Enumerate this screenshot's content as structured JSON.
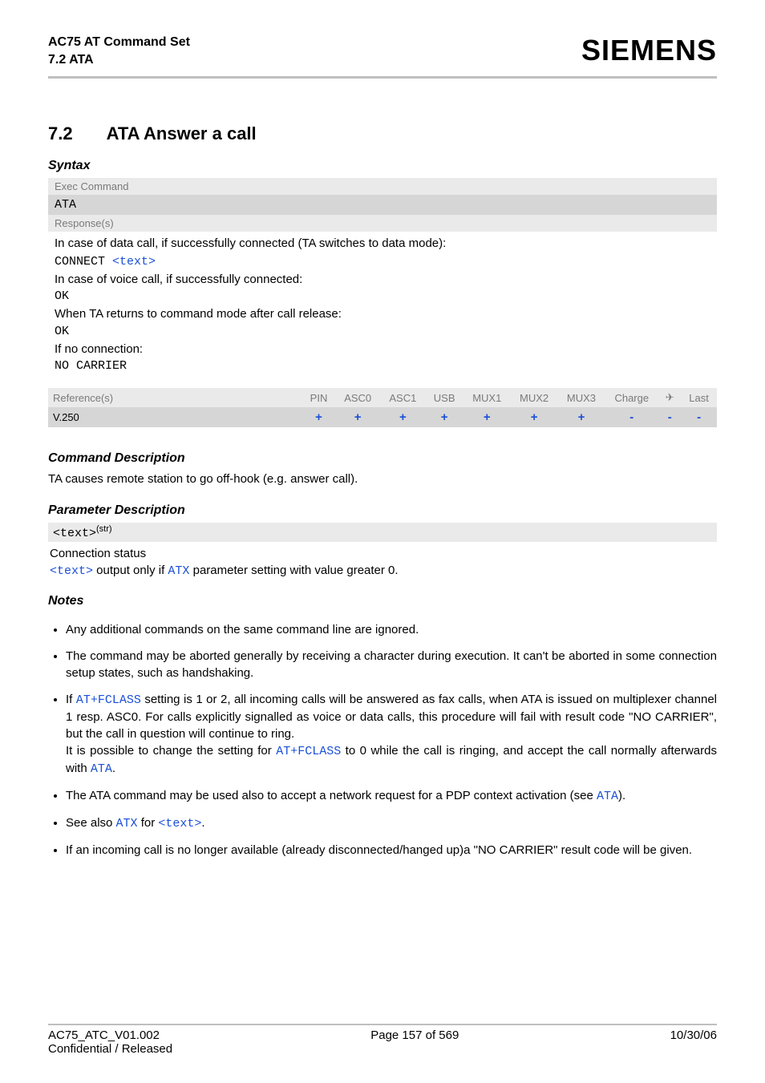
{
  "header": {
    "product": "AC75 AT Command Set",
    "section_ref": "7.2 ATA",
    "brand": "SIEMENS"
  },
  "title": {
    "num": "7.2",
    "rest": "ATA   Answer a call"
  },
  "syntax": {
    "heading": "Syntax",
    "exec_label": "Exec Command",
    "exec_cmd": "ATA",
    "resp_label": "Response(s)",
    "body_line1": "In case of data call, if successfully connected (TA switches to data mode):",
    "connect_prefix": "CONNECT ",
    "connect_link": "<text>",
    "body_line2": "In case of voice call, if successfully connected:",
    "ok1": "OK",
    "body_line3": "When TA returns to command mode after call release:",
    "ok2": "OK",
    "body_line4": "If no connection:",
    "nocarrier": "NO CARRIER"
  },
  "reftable": {
    "head": [
      "Reference(s)",
      "PIN",
      "ASC0",
      "ASC1",
      "USB",
      "MUX1",
      "MUX2",
      "MUX3",
      "Charge",
      "✈",
      "Last"
    ],
    "row_label": "V.250",
    "row_vals": [
      "+",
      "+",
      "+",
      "+",
      "+",
      "+",
      "+",
      "-",
      "-",
      "-"
    ]
  },
  "cmddesc": {
    "heading": "Command Description",
    "text": "TA causes remote station to go off-hook (e.g. answer call)."
  },
  "paramdesc": {
    "heading": "Parameter Description",
    "param_name": "<text>",
    "param_sup": "(str)",
    "status_label": "Connection status",
    "desc_link1": "<text>",
    "desc_mid": " output only if ",
    "desc_link2": "ATX",
    "desc_tail": " parameter setting with value greater 0."
  },
  "notes": {
    "heading": "Notes",
    "items": {
      "n1": "Any additional commands on the same command line are ignored.",
      "n2": "The command may be aborted generally by receiving a character during execution. It can't be aborted in some connection setup states, such as handshaking.",
      "n3a": "If ",
      "n3_link1": "AT+FCLASS",
      "n3b": " setting is 1 or 2, all incoming calls will be answered as fax calls, when ATA is issued on multiplexer channel 1 resp. ASC0. For calls explicitly signalled as voice or data calls, this procedure will fail with result code \"NO CARRIER\", but the call in question will continue to ring.",
      "n3c": "It is possible to change the setting for ",
      "n3_link2": "AT+FCLASS",
      "n3d": " to 0 while the call is ringing, and accept the call normally afterwards with ",
      "n3_link3": "ATA",
      "n3e": ".",
      "n4a": "The ATA command may be used also to accept a network request for a PDP context activation (see ",
      "n4_link": "ATA",
      "n4b": ").",
      "n5a": "See also ",
      "n5_link1": "ATX",
      "n5b": " for ",
      "n5_link2": "<text>",
      "n5c": ".",
      "n6": "If an incoming call is no longer available (already disconnected/hanged up)a \"NO CARRIER\" result code will be given."
    }
  },
  "footer": {
    "left": "AC75_ATC_V01.002",
    "center": "Page 157 of 569",
    "right": "10/30/06",
    "left2": "Confidential / Released"
  }
}
